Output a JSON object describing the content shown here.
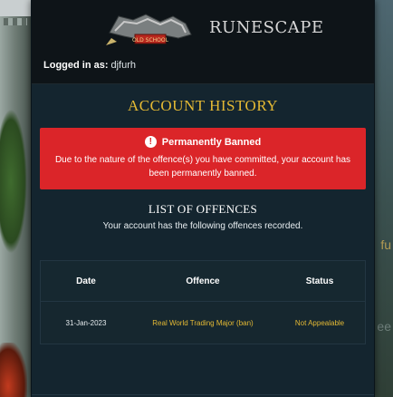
{
  "header": {
    "osrs_logo_text": "OLD SCHOOL",
    "runescape_logo": "RUNESCAPE",
    "logged_in_label": "Logged in as:",
    "username": "djfurh"
  },
  "page_title": "ACCOUNT HISTORY",
  "alert": {
    "title": "Permanently Banned",
    "body": "Due to the nature of the offence(s) you have committed, your account has been permanently banned.",
    "color": "#db2529"
  },
  "offences": {
    "title": "LIST OF OFFENCES",
    "description": "Your account has the following offences recorded.",
    "columns": [
      "Date",
      "Offence",
      "Status"
    ],
    "rows": [
      {
        "date": "31-Jan-2023",
        "offence": "Real World Trading Major (ban)",
        "status": "Not Appealable"
      }
    ]
  },
  "colors": {
    "accent_gold": "#e4b934",
    "panel_bg": "#14252f"
  }
}
